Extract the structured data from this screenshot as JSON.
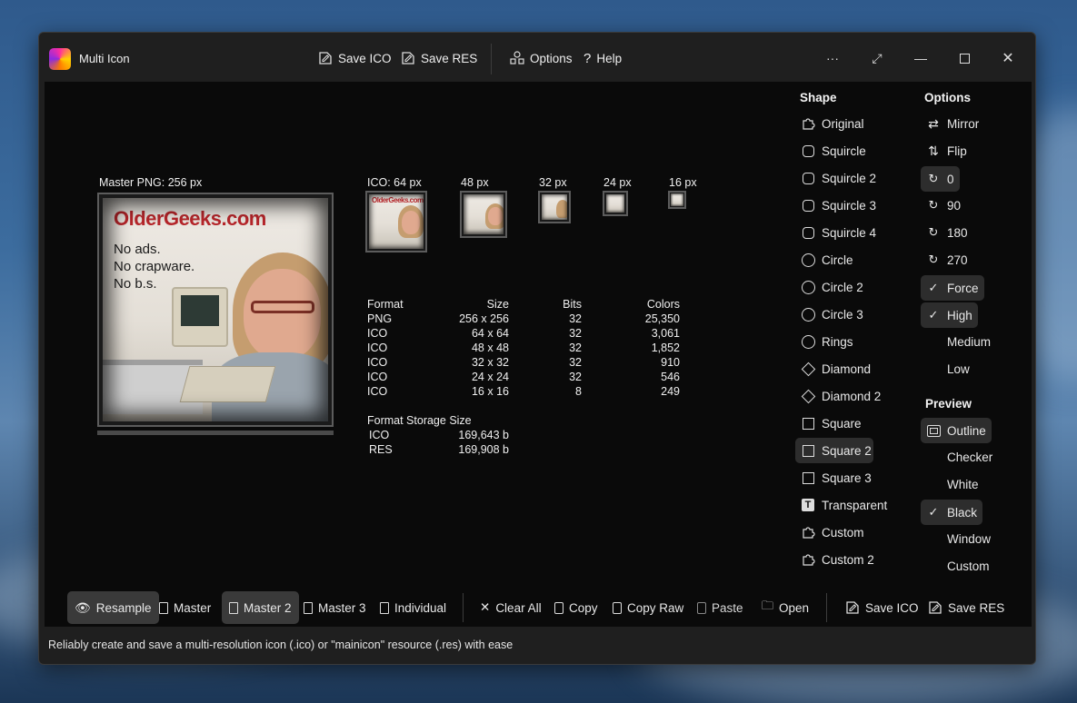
{
  "app": {
    "title": "Multi Icon"
  },
  "toolbar": {
    "save_ico": "Save ICO",
    "save_res": "Save RES",
    "options": "Options",
    "help": "Help",
    "more": "···"
  },
  "preview": {
    "master_label": "Master  PNG: 256 px",
    "photo_text": {
      "brand": "OlderGeeks.com",
      "lines": [
        "No ads.",
        "No crapware.",
        "No b.s."
      ]
    },
    "ico_labels": {
      "ico64": "ICO: 64 px",
      "p48": "48 px",
      "p32": "32 px",
      "p24": "24 px",
      "p16": "16 px"
    }
  },
  "format_table": {
    "headers": [
      "Format",
      "Size",
      "Bits",
      "Colors"
    ],
    "rows": [
      [
        "PNG",
        "256 x 256",
        "32",
        "25,350"
      ],
      [
        "ICO",
        "64 x 64",
        "32",
        "3,061"
      ],
      [
        "ICO",
        "48 x 48",
        "32",
        "1,852"
      ],
      [
        "ICO",
        "32 x 32",
        "32",
        "910"
      ],
      [
        "ICO",
        "24 x 24",
        "32",
        "546"
      ],
      [
        "ICO",
        "16 x 16",
        "8",
        "249"
      ]
    ]
  },
  "storage": {
    "title": "Format Storage Size",
    "rows": [
      [
        "ICO",
        "169,643 b"
      ],
      [
        "RES",
        "169,908 b"
      ]
    ]
  },
  "shape": {
    "title": "Shape",
    "items": [
      "Original",
      "Squircle",
      "Squircle 2",
      "Squircle 3",
      "Squircle 4",
      "Circle",
      "Circle 2",
      "Circle 3",
      "Rings",
      "Diamond",
      "Diamond 2",
      "Square",
      "Square 2",
      "Square 3",
      "Transparent",
      "Custom",
      "Custom 2"
    ],
    "selected": "Square 2"
  },
  "options": {
    "title": "Options",
    "mirror": "Mirror",
    "flip": "Flip",
    "rotations": [
      "0",
      "90",
      "180",
      "270"
    ],
    "force": "Force",
    "high": "High",
    "medium": "Medium",
    "low": "Low"
  },
  "preview_opts": {
    "title": "Preview",
    "items": [
      "Outline",
      "Checker",
      "White",
      "Black",
      "Window",
      "Custom"
    ]
  },
  "bottom": {
    "resample": "Resample",
    "master": "Master",
    "master2": "Master 2",
    "master3": "Master 3",
    "individual": "Individual",
    "clear_all": "Clear All",
    "copy": "Copy",
    "copy_raw": "Copy Raw",
    "paste": "Paste",
    "open": "Open",
    "save_ico": "Save ICO",
    "save_res": "Save RES"
  },
  "status": "Reliably create and save a multi-resolution icon (.ico) or \"mainicon\" resource (.res) with ease"
}
